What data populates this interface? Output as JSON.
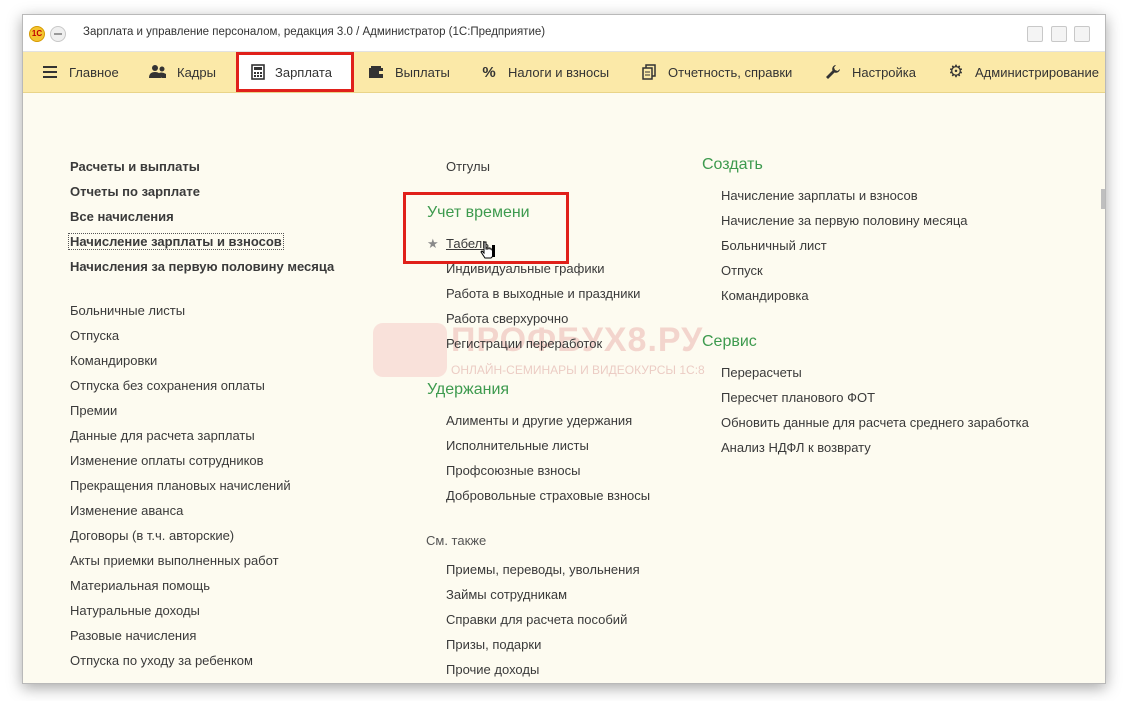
{
  "titlebar": {
    "logo_text": "1С",
    "title": "Зарплата и управление персоналом, редакция 3.0 / Администратор  (1С:Предприятие)"
  },
  "toolbar": {
    "tabs": [
      {
        "label": "Главное",
        "icon": "hamburger-icon"
      },
      {
        "label": "Кадры",
        "icon": "users-icon"
      },
      {
        "label": "Зарплата",
        "icon": "calculator-icon"
      },
      {
        "label": "Выплаты",
        "icon": "wallet-icon"
      },
      {
        "label": "Налоги и взносы",
        "icon": "percent-icon"
      },
      {
        "label": "Отчетность, справки",
        "icon": "documents-icon"
      },
      {
        "label": "Настройка",
        "icon": "wrench-icon"
      },
      {
        "label": "Администрирование",
        "icon": "gear-icon"
      }
    ],
    "active_tab": "Зарплата"
  },
  "col1": {
    "bold_items": [
      "Расчеты и выплаты",
      "Отчеты по зарплате",
      "Все начисления",
      "Начисление зарплаты и взносов",
      "Начисления за первую половину месяца"
    ],
    "items": [
      "Больничные листы",
      "Отпуска",
      "Командировки",
      "Отпуска без сохранения оплаты",
      "Премии",
      "Данные для расчета зарплаты",
      "Изменение оплаты сотрудников",
      "Прекращения плановых начислений",
      "Изменение аванса",
      "Договоры (в т.ч. авторские)",
      "Акты приемки выполненных работ",
      "Материальная помощь",
      "Натуральные доходы",
      "Разовые начисления",
      "Отпуска по уходу за ребенком"
    ]
  },
  "col2": {
    "top_item": "Отгулы",
    "time_header": "Учет времени",
    "time_items": [
      "Табель",
      "Индивидуальные графики",
      "Работа в выходные и праздники",
      "Работа сверхурочно",
      "Регистрации переработок"
    ],
    "deductions_header": "Удержания",
    "deductions_items": [
      "Алименты и другие удержания",
      "Исполнительные листы",
      "Профсоюзные взносы",
      "Добровольные страховые взносы"
    ],
    "see_also_header": "См. также",
    "see_also_items": [
      "Приемы, переводы, увольнения",
      "Займы сотрудникам",
      "Справки для расчета пособий",
      "Призы, подарки",
      "Прочие доходы"
    ]
  },
  "col3": {
    "create_header": "Создать",
    "create_items": [
      "Начисление зарплаты и взносов",
      "Начисление за первую половину месяца",
      "Больничный лист",
      "Отпуск",
      "Командировка"
    ],
    "service_header": "Сервис",
    "service_items": [
      "Перерасчеты",
      "Пересчет планового ФОТ",
      "Обновить данные для расчета среднего заработка",
      "Анализ НДФЛ к возврату"
    ]
  },
  "watermark": {
    "text": "ПРОФБУХ8.РУ",
    "subtext": "ОНЛАЙН-СЕМИНАРЫ И ВИДЕОКУРСЫ 1С:8"
  },
  "colors": {
    "toolbar_bg": "#fbe9a8",
    "content_bg": "#fdfbf0",
    "section_header": "#3d9a4e",
    "highlight_red": "#e0201a"
  }
}
